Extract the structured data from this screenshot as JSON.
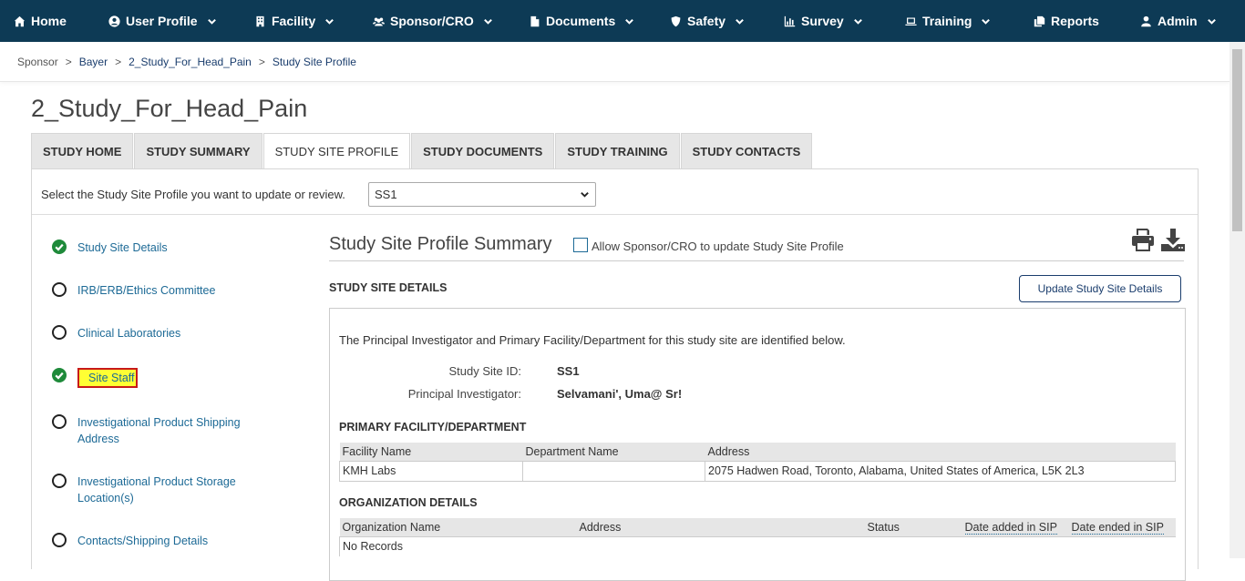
{
  "nav": {
    "home": "Home",
    "user_profile": "User Profile",
    "facility": "Facility",
    "sponsor_cro": "Sponsor/CRO",
    "documents": "Documents",
    "safety": "Safety",
    "survey": "Survey",
    "training": "Training",
    "reports": "Reports",
    "admin": "Admin"
  },
  "breadcrumb": {
    "items": [
      "Sponsor",
      "Bayer",
      "2_Study_For_Head_Pain",
      "Study Site Profile"
    ],
    "separator": ">"
  },
  "page_title": "2_Study_For_Head_Pain",
  "tabs": [
    "STUDY HOME",
    "STUDY SUMMARY",
    "STUDY SITE PROFILE",
    "STUDY DOCUMENTS",
    "STUDY TRAINING",
    "STUDY CONTACTS"
  ],
  "active_tab": "STUDY SITE PROFILE",
  "selector": {
    "label": "Select the Study Site Profile you want to update or review.",
    "selected": "SS1"
  },
  "steps": [
    {
      "label": "Study Site Details",
      "complete": true
    },
    {
      "label": "IRB/ERB/Ethics Committee",
      "complete": false
    },
    {
      "label": "Clinical Laboratories",
      "complete": false
    },
    {
      "label": "Site Staff",
      "complete": true,
      "highlighted": true
    },
    {
      "label_line1": "Investigational Product Shipping",
      "label_line2": "Address",
      "complete": false
    },
    {
      "label_line1": "Investigational Product Storage",
      "label_line2": "Location(s)",
      "complete": false
    },
    {
      "label": "Contacts/Shipping Details",
      "complete": false
    }
  ],
  "summary": {
    "title": "Study Site Profile Summary",
    "allow_label": "Allow Sponsor/CRO to update Study Site Profile",
    "allow_checked": false,
    "print_icon": "print-icon",
    "download_icon": "download-icon"
  },
  "study_site_details": {
    "heading": "STUDY SITE DETAILS",
    "update_button": "Update Study Site Details",
    "intro": "The Principal Investigator and Primary Facility/Department for this study site are identified below.",
    "site_id_label": "Study Site ID:",
    "site_id_value": "SS1",
    "pi_label": "Principal Investigator:",
    "pi_value": "Selvamani', Uma@ Sr!"
  },
  "primary_facility": {
    "heading": "PRIMARY FACILITY/DEPARTMENT",
    "columns": [
      "Facility Name",
      "Department Name",
      "Address"
    ],
    "rows": [
      [
        "KMH Labs",
        "",
        "2075 Hadwen Road, Toronto, Alabama, United States of America, L5K 2L3"
      ]
    ]
  },
  "organization_details": {
    "heading": "ORGANIZATION DETAILS",
    "columns": [
      "Organization Name",
      "Address",
      "Status",
      "Date added in SIP",
      "Date ended in SIP"
    ],
    "empty_text": "No Records"
  },
  "colors": {
    "nav_bg": "#0d3a55",
    "link": "#1d6a96",
    "check_green": "#1e8a3a",
    "highlight_yellow": "#ffff33",
    "highlight_border": "#c81919"
  }
}
